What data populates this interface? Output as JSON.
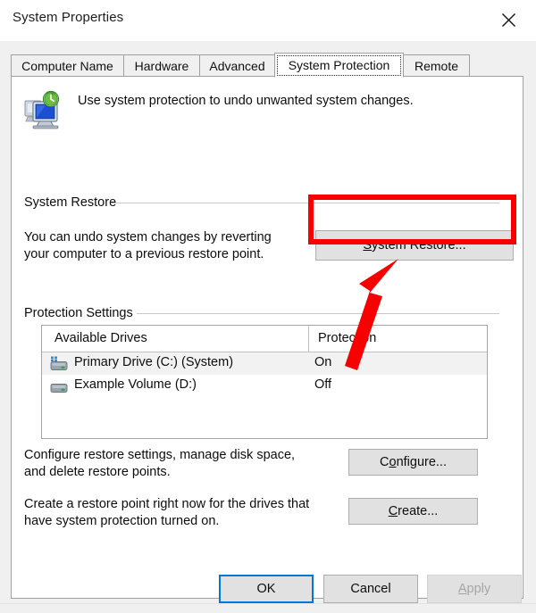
{
  "window": {
    "title": "System Properties",
    "close_icon": "close-x-icon"
  },
  "tabs": [
    {
      "label": "Computer Name",
      "selected": false
    },
    {
      "label": "Hardware",
      "selected": false
    },
    {
      "label": "Advanced",
      "selected": false
    },
    {
      "label": "System Protection",
      "selected": true
    },
    {
      "label": "Remote",
      "selected": false
    }
  ],
  "intro": {
    "icon": "system-protection-computer-clock-icon",
    "text": "Use system protection to undo unwanted system changes."
  },
  "system_restore_group": {
    "label": "System Restore",
    "description": "You can undo system changes by reverting\nyour computer to a previous restore point.",
    "button": {
      "accel": "S",
      "rest": "ystem Restore..."
    }
  },
  "protection_settings_group": {
    "label": "Protection Settings",
    "columns": [
      "Available Drives",
      "Protection"
    ],
    "rows": [
      {
        "icon": "system-drive-icon",
        "name": "Primary Drive (C:) (System)",
        "protection": "On",
        "selected": true
      },
      {
        "icon": "drive-icon",
        "name": "Example Volume (D:)",
        "protection": "Off",
        "selected": false
      }
    ],
    "configure": {
      "description": "Configure restore settings, manage disk space,\nand delete restore points.",
      "button_pre": "C",
      "button_accel": "o",
      "button_rest": "nfigure..."
    },
    "create": {
      "description": "Create a restore point right now for the drives that\nhave system protection turned on.",
      "button_accel": "C",
      "button_rest": "reate..."
    }
  },
  "footer": {
    "ok": "OK",
    "cancel": "Cancel",
    "apply_accel": "A",
    "apply_rest": "pply"
  },
  "annotations": {
    "highlight_target": "System Restore...",
    "arrow": "red-arrow-pointing-to-system-restore-button",
    "highlight_color": "#f60000"
  }
}
